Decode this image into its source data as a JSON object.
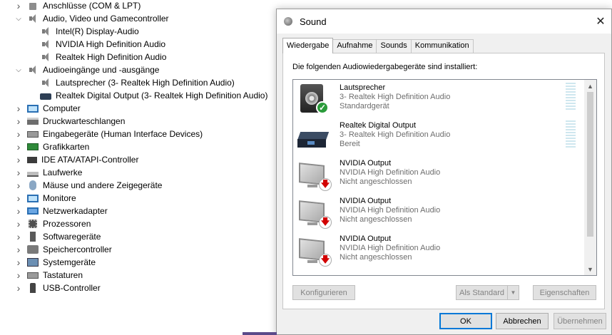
{
  "device_tree": [
    {
      "label": "Anschlüsse (COM & LPT)",
      "icon": "port-icon",
      "level": 0,
      "expanded": false
    },
    {
      "label": "Audio, Video und Gamecontroller",
      "icon": "speaker-icon",
      "level": 0,
      "expanded": true
    },
    {
      "label": "Intel(R) Display-Audio",
      "icon": "speaker-icon",
      "level": 1
    },
    {
      "label": "NVIDIA High Definition Audio",
      "icon": "speaker-icon",
      "level": 1
    },
    {
      "label": "Realtek High Definition Audio",
      "icon": "speaker-icon",
      "level": 1
    },
    {
      "label": "Audioeingänge und -ausgänge",
      "icon": "speaker-icon",
      "level": 0,
      "expanded": true
    },
    {
      "label": "Lautsprecher (3- Realtek High Definition Audio)",
      "icon": "speaker-icon",
      "level": 1
    },
    {
      "label": "Realtek Digital Output (3- Realtek High Definition Audio)",
      "icon": "digital-output-icon",
      "level": 1
    },
    {
      "label": "Computer",
      "icon": "monitor-icon",
      "level": 0,
      "expanded": false
    },
    {
      "label": "Druckwarteschlangen",
      "icon": "printer-icon",
      "level": 0,
      "expanded": false
    },
    {
      "label": "Eingabegeräte (Human Interface Devices)",
      "icon": "keyboard-icon",
      "level": 0,
      "expanded": false
    },
    {
      "label": "Grafikkarten",
      "icon": "gpu-icon",
      "level": 0,
      "expanded": false
    },
    {
      "label": "IDE ATA/ATAPI-Controller",
      "icon": "ide-icon",
      "level": 0,
      "expanded": false
    },
    {
      "label": "Laufwerke",
      "icon": "drive-icon",
      "level": 0,
      "expanded": false
    },
    {
      "label": "Mäuse und andere Zeigegeräte",
      "icon": "mouse-icon",
      "level": 0,
      "expanded": false
    },
    {
      "label": "Monitore",
      "icon": "monitor-icon",
      "level": 0,
      "expanded": false
    },
    {
      "label": "Netzwerkadapter",
      "icon": "network-icon",
      "level": 0,
      "expanded": false
    },
    {
      "label": "Prozessoren",
      "icon": "cpu-icon",
      "level": 0,
      "expanded": false
    },
    {
      "label": "Softwaregeräte",
      "icon": "software-icon",
      "level": 0,
      "expanded": false
    },
    {
      "label": "Speichercontroller",
      "icon": "storage-icon",
      "level": 0,
      "expanded": false
    },
    {
      "label": "Systemgeräte",
      "icon": "system-icon",
      "level": 0,
      "expanded": false
    },
    {
      "label": "Tastaturen",
      "icon": "keyboard-icon",
      "level": 0,
      "expanded": false
    },
    {
      "label": "USB-Controller",
      "icon": "usb-icon",
      "level": 0,
      "expanded": false
    }
  ],
  "dialog": {
    "title": "Sound",
    "close_glyph": "✕",
    "tabs": [
      "Wiedergabe",
      "Aufnahme",
      "Sounds",
      "Kommunikation"
    ],
    "active_tab": "Wiedergabe",
    "instruction": "Die folgenden Audiowiedergabegeräte sind installiert:",
    "devices": [
      {
        "name": "Lautsprecher",
        "driver": "3- Realtek High Definition Audio",
        "status": "Standardgerät",
        "icon": "speaker-icon",
        "badge": "check-badge-icon"
      },
      {
        "name": "Realtek Digital Output",
        "driver": "3- Realtek High Definition Audio",
        "status": "Bereit",
        "icon": "digital-output-icon",
        "badge": ""
      },
      {
        "name": "NVIDIA Output",
        "driver": "NVIDIA High Definition Audio",
        "status": "Nicht angeschlossen",
        "icon": "monitor-icon",
        "badge": "unplugged-badge-icon"
      },
      {
        "name": "NVIDIA Output",
        "driver": "NVIDIA High Definition Audio",
        "status": "Nicht angeschlossen",
        "icon": "monitor-icon",
        "badge": "unplugged-badge-icon"
      },
      {
        "name": "NVIDIA Output",
        "driver": "NVIDIA High Definition Audio",
        "status": "Nicht angeschlossen",
        "icon": "monitor-icon",
        "badge": "unplugged-badge-icon"
      }
    ],
    "buttons": {
      "configure": "Konfigurieren",
      "set_default": "Als Standard",
      "properties": "Eigenschaften",
      "ok": "OK",
      "cancel": "Abbrechen",
      "apply": "Übernehmen"
    },
    "colors": {
      "accent": "#0078d7",
      "ok_badge": "#2a9b3a",
      "unplugged_arrow": "#d20000"
    }
  }
}
